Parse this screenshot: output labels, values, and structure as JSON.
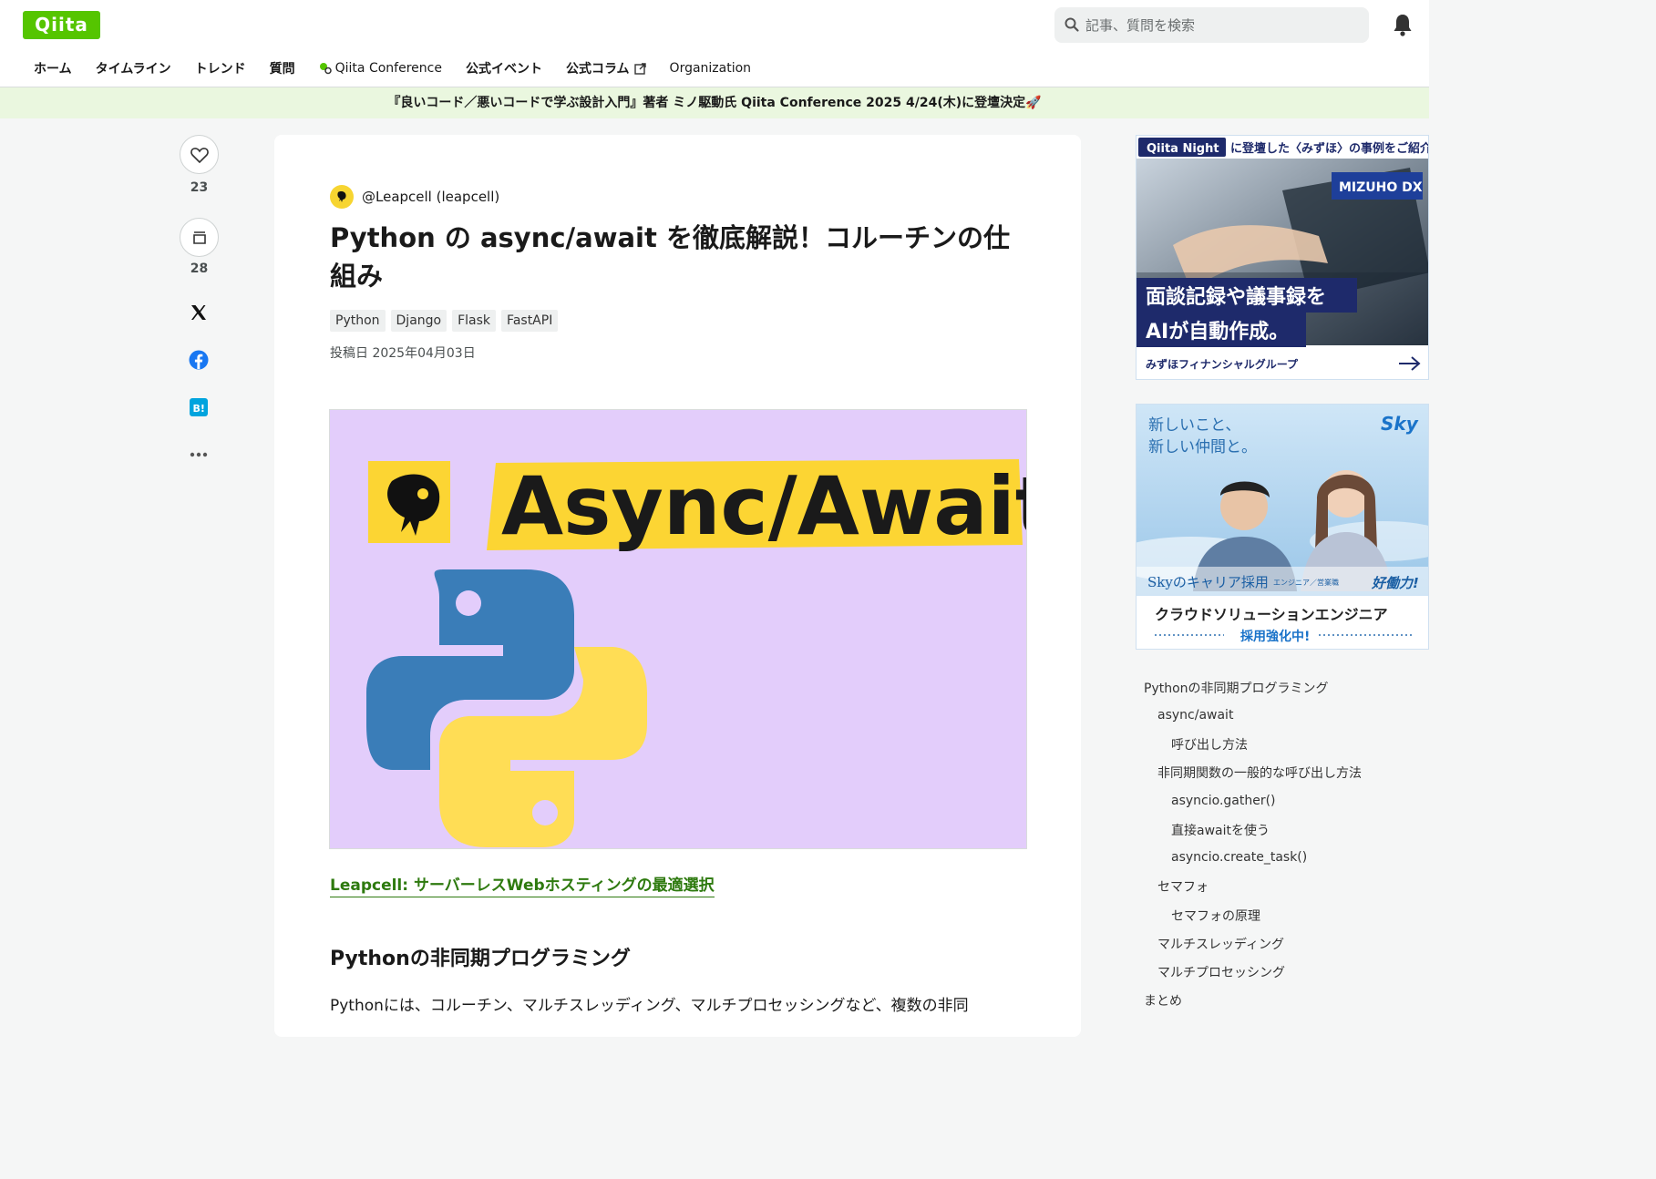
{
  "header": {
    "logo": "Qiita",
    "search_placeholder": "記事、質問を検索",
    "nav": [
      {
        "label": "ホーム"
      },
      {
        "label": "タイムライン"
      },
      {
        "label": "トレンド"
      },
      {
        "label": "質問"
      },
      {
        "label": "Qiita Conference"
      },
      {
        "label": "公式イベント"
      },
      {
        "label": "公式コラム"
      },
      {
        "label": "Organization"
      }
    ]
  },
  "announcement": {
    "text": "『良いコード／悪いコードで学ぶ設計入門』著者 ミノ駆動氏 Qiita Conference 2025 4/24(木)に登壇決定",
    "emoji": "🚀"
  },
  "actions": {
    "likes": "23",
    "stocks": "28"
  },
  "article": {
    "author": "@Leapcell (leapcell)",
    "title": "Python の async/await を徹底解説！コルーチンの仕組み",
    "tags": [
      "Python",
      "Django",
      "Flask",
      "FastAPI"
    ],
    "posted": "投稿日 2025年04月03日",
    "hero_text": "Async/Await",
    "link": "Leapcell: サーバーレスWebホスティングの最適選択",
    "section_heading": "Pythonの非同期プログラミング",
    "section_paragraph": "Pythonには、コルーチン、マルチスレッディング、マルチプロセッシングなど、複数の非同"
  },
  "ads": {
    "ad1": {
      "badge": "Qiita Night",
      "headline": "に登壇した〈みずほ〉の事例をご紹介",
      "corner": "MIZUHO DX",
      "line1": "面談記録や議事録を",
      "line2": "AIが自動作成。",
      "footer": "みずほフィナンシャルグループ"
    },
    "ad2": {
      "copy1": "新しいこと、",
      "copy2": "新しい仲間と。",
      "brand": "Sky",
      "career": "Skyのキャリア採用",
      "career_sub": "エンジニア／営業職",
      "slogan": "好働力!",
      "job": "クラウドソリューションエンジニア",
      "hiring": "採用強化中!"
    }
  },
  "toc": [
    {
      "label": "Pythonの非同期プログラミング",
      "level": 1
    },
    {
      "label": "async/await",
      "level": 2
    },
    {
      "label": "呼び出し方法",
      "level": 3
    },
    {
      "label": "非同期関数の一般的な呼び出し方法",
      "level": 2
    },
    {
      "label": "asyncio.gather()",
      "level": 3
    },
    {
      "label": "直接awaitを使う",
      "level": 3
    },
    {
      "label": "asyncio.create_task()",
      "level": 3
    },
    {
      "label": "セマフォ",
      "level": 2
    },
    {
      "label": "セマフォの原理",
      "level": 3
    },
    {
      "label": "マルチスレッディング",
      "level": 2
    },
    {
      "label": "マルチプロセッシング",
      "level": 2
    },
    {
      "label": "まとめ",
      "level": 1
    }
  ],
  "colors": {
    "brand": "#55c500",
    "link": "#2e7a0f",
    "hero_bg": "#e3cdfb",
    "python_blue": "#3a7db8",
    "python_yellow": "#ffdd55"
  }
}
